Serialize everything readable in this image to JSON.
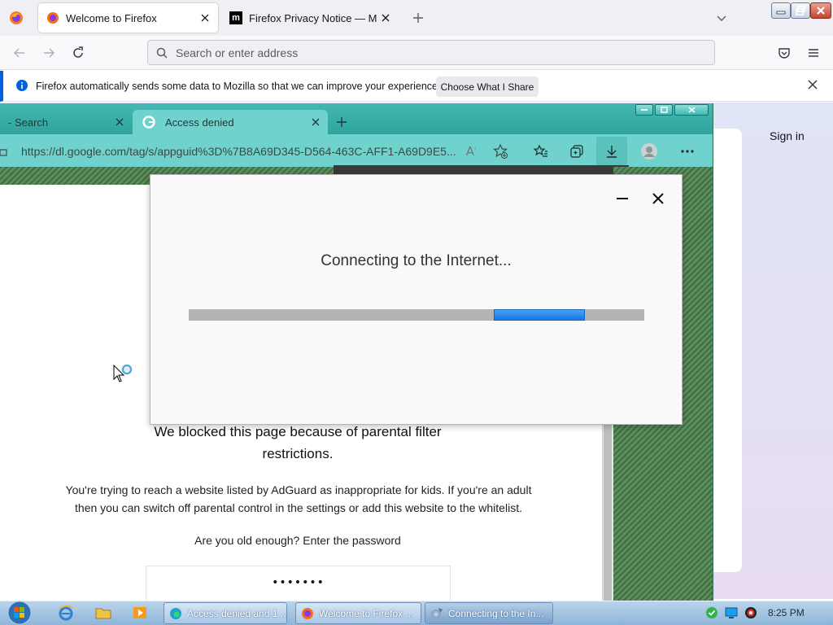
{
  "firefox": {
    "tabs": [
      {
        "label": "Welcome to Firefox",
        "active": true
      },
      {
        "label": "Firefox Privacy Notice — Mozilla",
        "active": false
      }
    ],
    "address_placeholder": "Search or enter address",
    "notification": {
      "text": "Firefox automatically sends some data to Mozilla so that we can improve your experience.",
      "button": "Choose What I Share"
    },
    "signin": "Sign in"
  },
  "edge": {
    "tabs": [
      {
        "label": "- Search",
        "active": false
      },
      {
        "label": "Access denied",
        "active": true
      }
    ],
    "url": "https://dl.google.com/tag/s/appguid%3D%7B8A69D345-D564-463C-AFF1-A69D9E5...",
    "page": {
      "heading": "We blocked this page because of parental filter restrictions.",
      "description": "You're trying to reach a website listed by AdGuard as inappropriate for kids. If you're an adult then you can switch off parental control in the settings or add this website to the whitelist.",
      "question": "Are you old enough? Enter the password",
      "password_value": "•••••••"
    }
  },
  "dialog": {
    "title": "Connecting to the Internet...",
    "progress": {
      "start": 0.67,
      "end": 0.87
    }
  },
  "taskbar": {
    "tasks": [
      {
        "label": "Access denied and 1 ...",
        "active": false
      },
      {
        "label": "Welcome to Firefox ...",
        "active": false
      },
      {
        "label": "Connecting to the In...",
        "active": true
      }
    ],
    "clock": "8:25 PM"
  },
  "colors": {
    "edge_accent": "#6fd2cc",
    "progress_blue": "#1976e0",
    "firefox_info": "#0060df"
  }
}
